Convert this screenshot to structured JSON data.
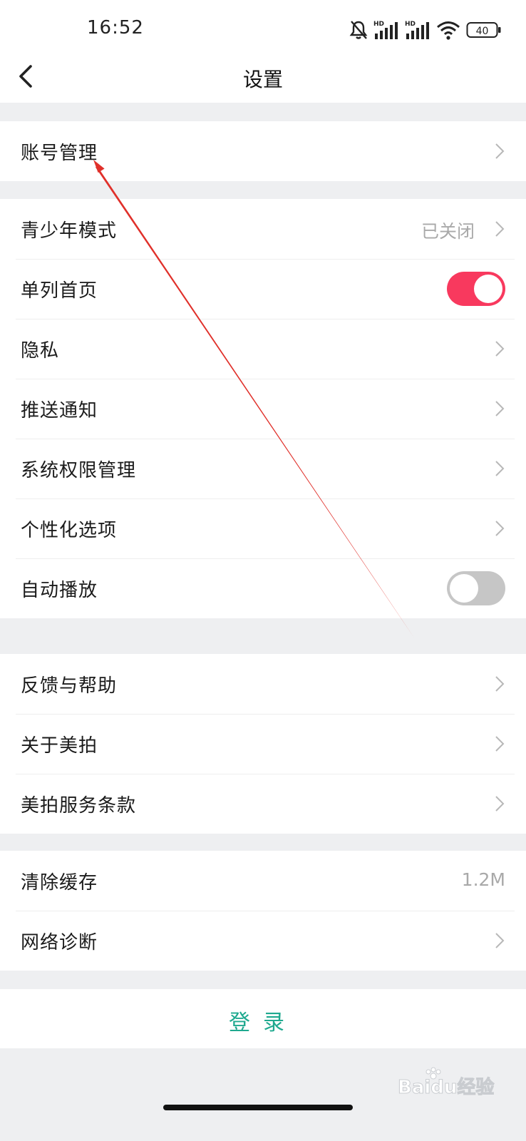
{
  "status_bar": {
    "time": "16:52",
    "network_1": "HD",
    "network_2": "HD",
    "battery": "40"
  },
  "nav": {
    "title": "设置"
  },
  "section_account": [
    {
      "label": "账号管理",
      "control": "chevron"
    }
  ],
  "section_general": [
    {
      "label": "青少年模式",
      "value": "已关闭",
      "control": "chevron"
    },
    {
      "label": "单列首页",
      "control": "toggle",
      "on": true
    },
    {
      "label": "隐私",
      "control": "chevron"
    },
    {
      "label": "推送通知",
      "control": "chevron"
    },
    {
      "label": "系统权限管理",
      "control": "chevron"
    },
    {
      "label": "个性化选项",
      "control": "chevron"
    },
    {
      "label": "自动播放",
      "control": "toggle",
      "on": false
    }
  ],
  "section_about": [
    {
      "label": "反馈与帮助",
      "control": "chevron"
    },
    {
      "label": "关于美拍",
      "control": "chevron"
    },
    {
      "label": "美拍服务条款",
      "control": "chevron"
    }
  ],
  "section_tools": [
    {
      "label": "清除缓存",
      "value": "1.2M",
      "control": "value"
    },
    {
      "label": "网络诊断",
      "control": "chevron"
    }
  ],
  "login": {
    "label": "登录"
  },
  "watermark": {
    "text": "Baidu经验"
  },
  "colors": {
    "toggle_on": "#f8395e",
    "toggle_off": "#c6c6c6",
    "login_text": "#1fa98f",
    "annotation_arrow": "#e0302a",
    "page_background": "#eeeff1"
  }
}
